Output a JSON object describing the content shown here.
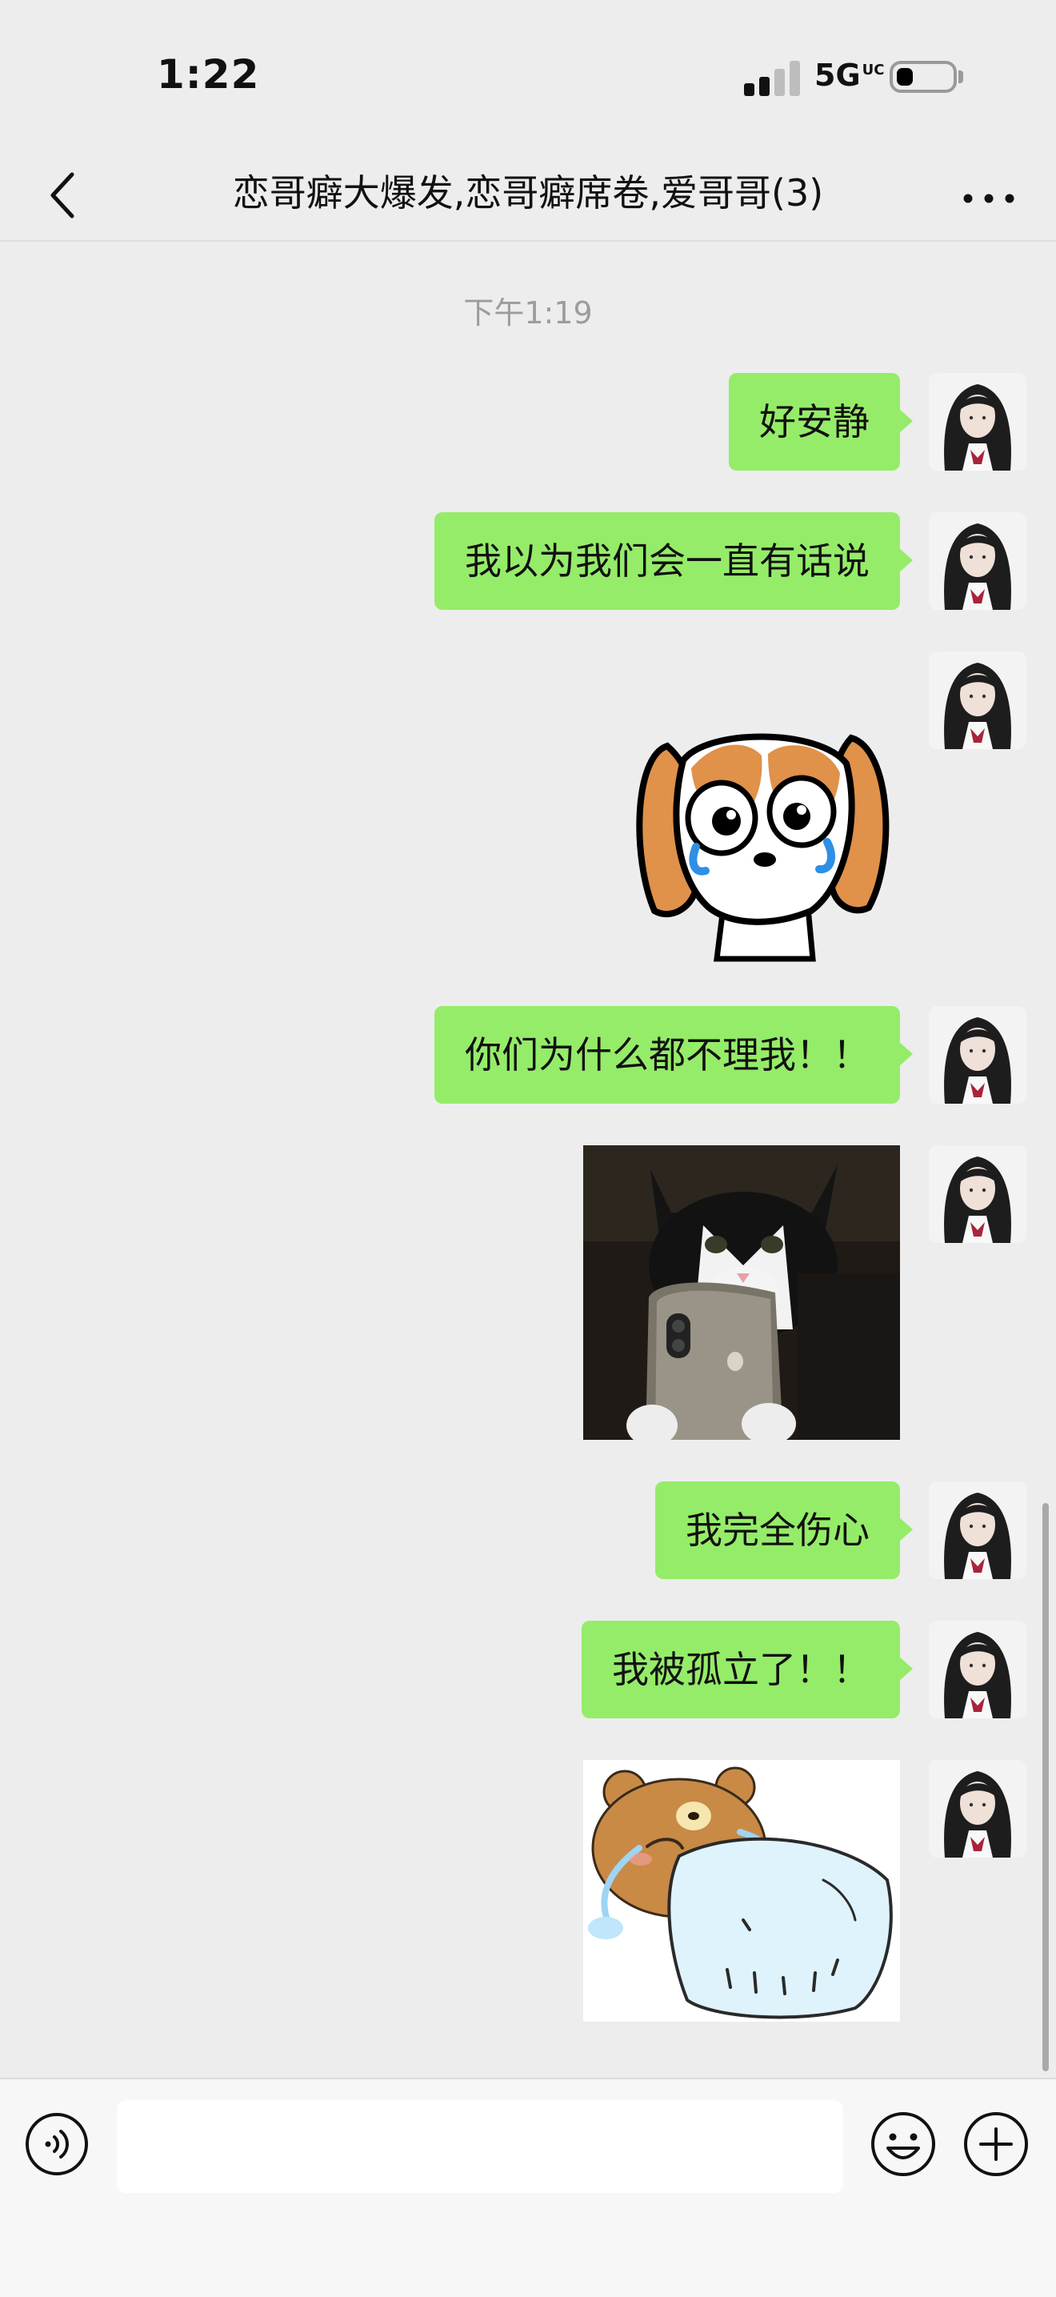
{
  "status_bar": {
    "time": "1:22",
    "network": "5G",
    "network_suffix": "UC"
  },
  "header": {
    "title": "恋哥癖大爆发,恋哥癖席卷,爱哥哥(3)"
  },
  "chat": {
    "timestamp": "下午1:19",
    "messages": [
      {
        "type": "text",
        "text": "好安静"
      },
      {
        "type": "text",
        "text": "我以为我们会一直有话说"
      },
      {
        "type": "sticker",
        "sticker": "crying-dog-sticker"
      },
      {
        "type": "text",
        "text": "你们为什么都不理我！！"
      },
      {
        "type": "image",
        "image": "crying-cat-phone-photo"
      },
      {
        "type": "text",
        "text": "我完全伤心"
      },
      {
        "type": "text",
        "text": "我被孤立了！！"
      },
      {
        "type": "sticker",
        "sticker": "crying-bear-pillow-sticker"
      }
    ]
  },
  "colors": {
    "bubble": "#95ec69",
    "background": "#ededed",
    "input_bar": "#f7f7f7"
  }
}
